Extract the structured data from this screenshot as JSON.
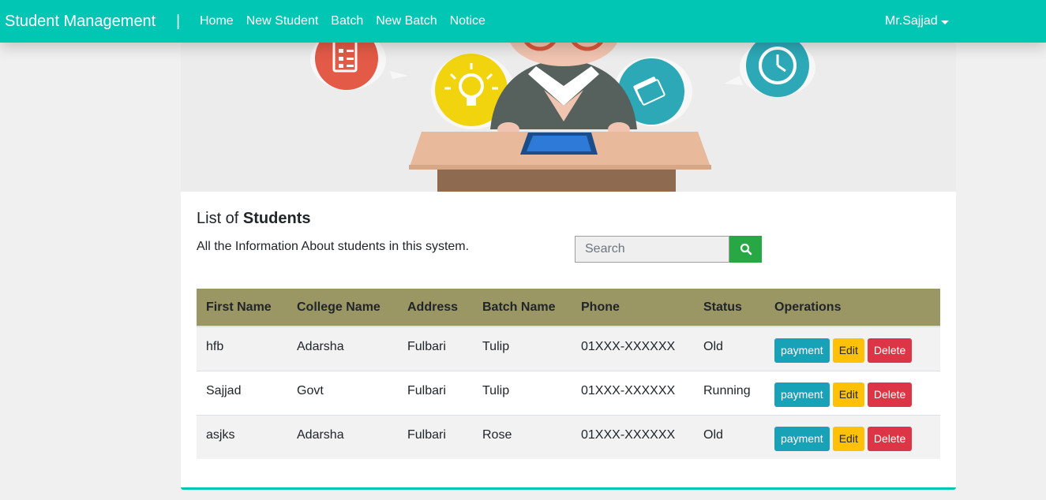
{
  "navbar": {
    "brand": "Student Management",
    "separator": "|",
    "links": [
      "Home",
      "New Student",
      "Batch",
      "New Batch",
      "Notice"
    ],
    "user": "Mr.Sajjad",
    "color": "#00c6b3"
  },
  "card": {
    "title_prefix": "List of ",
    "title_bold": "Students",
    "subtitle": "All the Information About students in this system."
  },
  "search": {
    "placeholder": "Search",
    "button_icon": "search-icon"
  },
  "table": {
    "headers": [
      "First Name",
      "College Name",
      "Address",
      "Batch Name",
      "Phone",
      "Status",
      "Operations"
    ],
    "rows": [
      {
        "first_name": "hfb",
        "college": "Adarsha",
        "address": "Fulbari",
        "batch": "Tulip",
        "phone": "01XXX-XXXXXX",
        "status": "Old"
      },
      {
        "first_name": "Sajjad",
        "college": "Govt",
        "address": "Fulbari",
        "batch": "Tulip",
        "phone": "01XXX-XXXXXX",
        "status": "Running"
      },
      {
        "first_name": "asjks",
        "college": "Adarsha",
        "address": "Fulbari",
        "batch": "Rose",
        "phone": "01XXX-XXXXXX",
        "status": "Old"
      }
    ],
    "ops": {
      "payment": "payment",
      "edit": "Edit",
      "delete": "Delete"
    }
  }
}
